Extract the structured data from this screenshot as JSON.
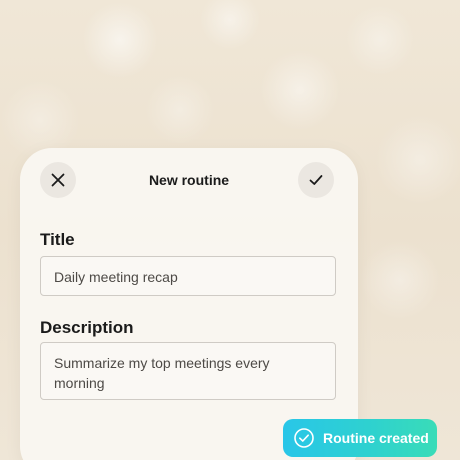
{
  "dialog": {
    "title": "New routine",
    "close_icon": "close-icon",
    "confirm_icon": "check-icon"
  },
  "form": {
    "title_label": "Title",
    "title_value": "Daily meeting recap",
    "description_label": "Description",
    "description_value": "Summarize my top meetings every morning"
  },
  "toast": {
    "message": "Routine created",
    "icon": "check-circle-icon",
    "gradient_start": "#29c6e8",
    "gradient_end": "#39dcb8"
  },
  "colors": {
    "background": "#efe6d6",
    "card": "#faf7f2",
    "text": "#1b1b1b"
  }
}
